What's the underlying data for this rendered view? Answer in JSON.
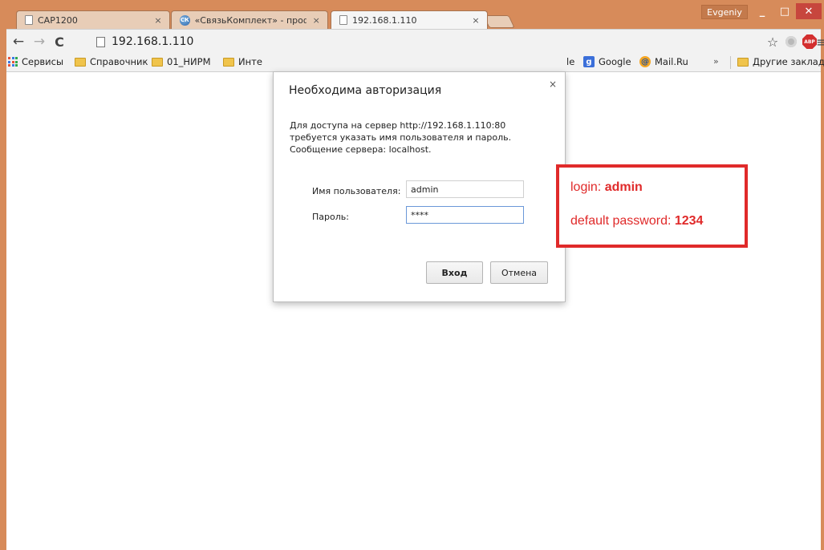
{
  "window": {
    "user": "Evgeniy",
    "min_glyph": "_",
    "max_glyph": "□",
    "close_glyph": "✕"
  },
  "tabs": [
    {
      "title": "CAP1200",
      "close": "×",
      "active": false
    },
    {
      "title": "«СвязьКомплект» - проф",
      "close": "×",
      "active": false
    },
    {
      "title": "192.168.1.110",
      "close": "×",
      "active": true
    }
  ],
  "toolbar": {
    "back": "←",
    "forward": "→",
    "reload": "C",
    "url": "192.168.1.110",
    "star": "☆",
    "menu": "≡",
    "abp": "ABP"
  },
  "bookmarks": {
    "items": [
      "Сервисы",
      "Справочник",
      "01_НИРМ",
      "Инте",
      "le",
      "Google",
      "Mail.Ru"
    ],
    "overflow": "»",
    "other": "Другие закладки"
  },
  "dialog": {
    "title": "Необходима авторизация",
    "close": "×",
    "message": "Для доступа на сервер http://192.168.1.110:80 требуется указать имя пользователя и пароль. Сообщение сервера: localhost.",
    "username_label": "Имя пользователя:",
    "username_value": "admin",
    "password_label": "Пароль:",
    "password_value": "****",
    "login_button": "Вход",
    "cancel_button": "Отмена"
  },
  "annotation": {
    "login_prefix": "login: ",
    "login_value": "admin",
    "password_prefix": "default password: ",
    "password_value": "1234",
    "border_color": "#e02a2a"
  }
}
